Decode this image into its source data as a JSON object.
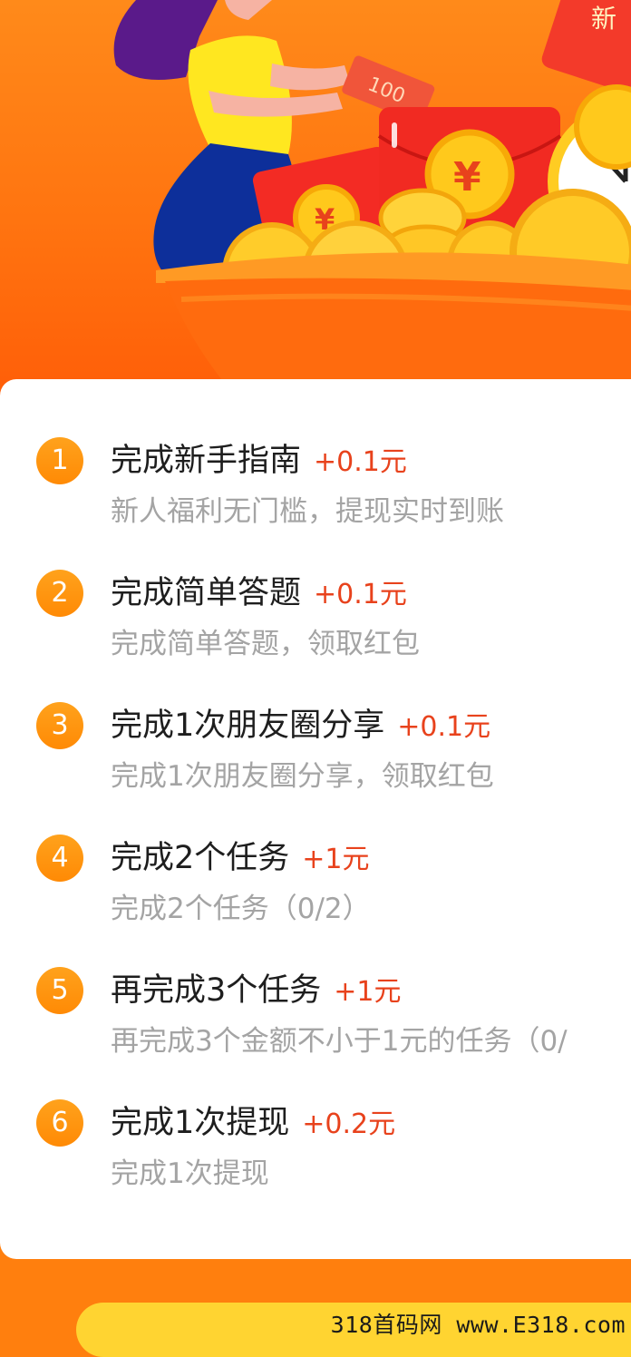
{
  "hero": {
    "envelope_note_text": "100",
    "corner_tag_text": "新",
    "coin_symbol": "¥"
  },
  "tasks": [
    {
      "num": "1",
      "title": "完成新手指南",
      "reward": "+0.1元",
      "desc": "新人福利无门槛，提现实时到账"
    },
    {
      "num": "2",
      "title": "完成简单答题",
      "reward": "+0.1元",
      "desc": "完成简单答题，领取红包"
    },
    {
      "num": "3",
      "title": "完成1次朋友圈分享",
      "reward": "+0.1元",
      "desc": "完成1次朋友圈分享，领取红包"
    },
    {
      "num": "4",
      "title": "完成2个任务",
      "reward": "+1元",
      "desc": "完成2个任务（0/2）"
    },
    {
      "num": "5",
      "title": "再完成3个任务",
      "reward": "+1元",
      "desc": "再完成3个金额不小于1元的任务（0/"
    },
    {
      "num": "6",
      "title": "完成1次提现",
      "reward": "+0.2元",
      "desc": "完成1次提现"
    }
  ],
  "watermark": "318首码网 www.E318.com",
  "colors": {
    "background": "#ff7f0e",
    "badge": "#ff9410",
    "reward": "#e8421c",
    "title": "#1e1e1e",
    "desc": "#a4a4a4",
    "button": "#ffd431"
  }
}
